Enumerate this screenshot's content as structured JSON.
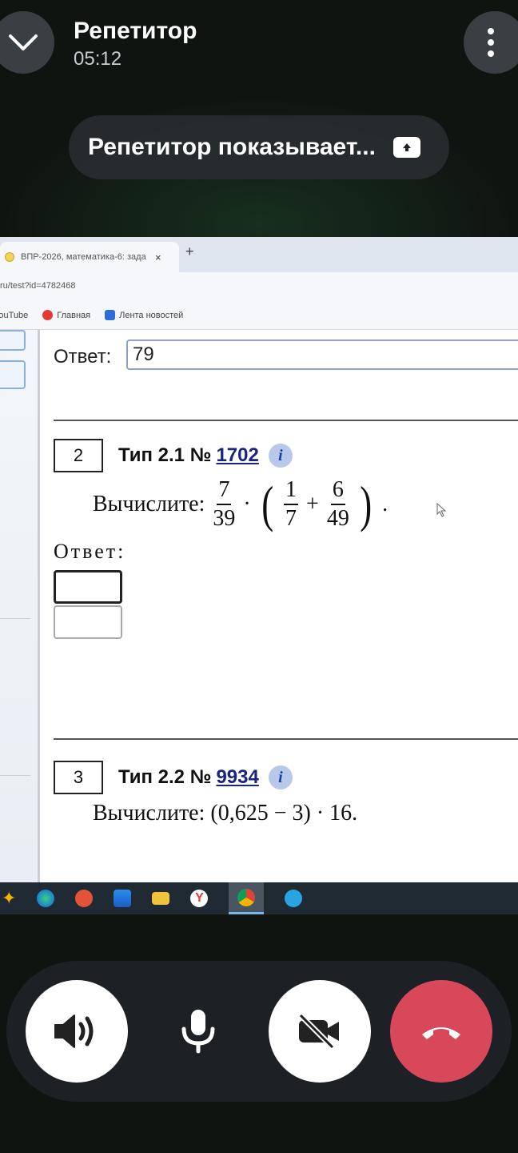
{
  "call": {
    "caller_name": "Репетитор",
    "duration": "05:12",
    "share_banner": "Репетитор показывает..."
  },
  "browser": {
    "tab_title": "ВПР-2026, математика-6: зада",
    "tab_close": "×",
    "new_tab": "+",
    "url": "ru/test?id=4782468",
    "bookmarks": [
      "YouTube",
      "Главная",
      "Лента новостей"
    ]
  },
  "test": {
    "prev_answer_label": "Ответ:",
    "prev_answer_value": "79",
    "task2": {
      "number": "2",
      "type": "Тип 2.1 №",
      "id": "1702",
      "prompt": "Вычислите:",
      "formula": {
        "a_num": "7",
        "a_den": "39",
        "b_num": "1",
        "b_den": "7",
        "c_num": "6",
        "c_den": "49"
      },
      "answer_label": "Ответ:"
    },
    "task3": {
      "number": "3",
      "type": "Тип 2.2 №",
      "id": "9934",
      "text": "Вычислите: (0,625 − 3) · 16."
    }
  },
  "colors": {
    "end_call": "#d9475a",
    "taskbar": "#202a33",
    "link": "#1a237e"
  },
  "controls": [
    "speaker-icon",
    "microphone-icon",
    "camera-off-icon",
    "end-call-icon"
  ]
}
